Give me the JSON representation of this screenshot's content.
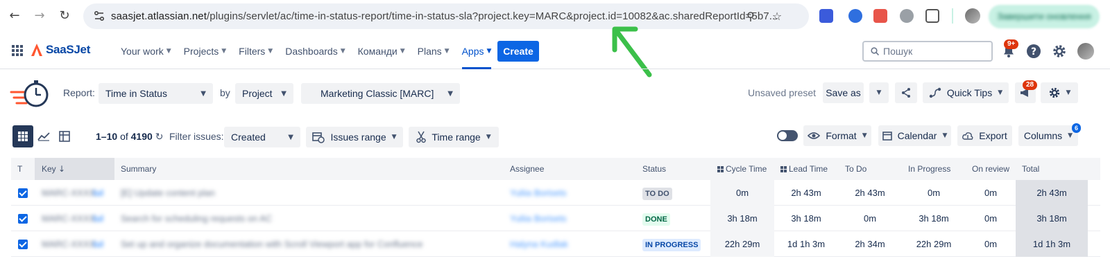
{
  "browser": {
    "url_host": "saasjet.atlassian.net",
    "url_path": "/plugins/servlet/ac/time-in-status-report/time-in-status-sla?project.key=MARC&project.id=10082&ac.sharedReportId=5b7...",
    "update_button_label": "Завершити оновлення"
  },
  "jira_nav": {
    "logo_text": "SaaSJet",
    "items": [
      {
        "label": "Your work"
      },
      {
        "label": "Projects"
      },
      {
        "label": "Filters"
      },
      {
        "label": "Dashboards"
      },
      {
        "label": "Команди"
      },
      {
        "label": "Plans"
      },
      {
        "label": "Apps"
      }
    ],
    "create_label": "Create",
    "search_placeholder": "Пошук",
    "notifications_badge": "9+"
  },
  "report_bar": {
    "report_label": "Report:",
    "report_value": "Time in Status",
    "by_label": "by",
    "by_value": "Project",
    "project_value": "Marketing Classic [MARC]",
    "preset_status": "Unsaved preset",
    "save_as_label": "Save as",
    "quick_tips_label": "Quick Tips",
    "alerts_badge": "28"
  },
  "filter_bar": {
    "range_start": "1",
    "range_end": "10",
    "of_label": "of",
    "total_count": "4190",
    "filter_label": "Filter issues:",
    "filter_value": "Created",
    "issues_range_label": "Issues range",
    "time_range_label": "Time range",
    "format_label": "Format",
    "calendar_label": "Calendar",
    "export_label": "Export",
    "columns_label": "Columns",
    "columns_badge": "6"
  },
  "table": {
    "headers": {
      "t": "T",
      "key": "Key",
      "summary": "Summary",
      "assignee": "Assignee",
      "status": "Status",
      "cycle_time": "Cycle Time",
      "lead_time": "Lead Time",
      "to_do": "To Do",
      "in_progress": "In Progress",
      "on_review": "On review",
      "total": "Total"
    },
    "rows": [
      {
        "key": "MARC-XXXX",
        "summary": "[E] Update content plan",
        "assignee": "Yuliia Borisets",
        "status": "TO DO",
        "cycle_time": "0m",
        "lead_time": "2h 43m",
        "to_do": "2h 43m",
        "in_progress": "0m",
        "on_review": "0m",
        "total": "2h 43m"
      },
      {
        "key": "MARC-XXXX",
        "summary": "Search for scheduling requests on AC",
        "assignee": "Yuliia Borisets",
        "status": "DONE",
        "cycle_time": "3h 18m",
        "lead_time": "3h 18m",
        "to_do": "0m",
        "in_progress": "3h 18m",
        "on_review": "0m",
        "total": "3h 18m"
      },
      {
        "key": "MARC-XXXX",
        "summary": "Set up and organize documentation with Scroll Viewport app for Confluence",
        "assignee": "Halyna Kudlak",
        "status": "IN PROGRESS",
        "cycle_time": "22h 29m",
        "lead_time": "1d 1h 3m",
        "to_do": "2h 34m",
        "in_progress": "22h 29m",
        "on_review": "0m",
        "total": "1d 1h 3m"
      }
    ]
  },
  "colors": {
    "jira_blue": "#0c66e4",
    "arrow_green": "#3cc04a",
    "badge_red": "#de350b"
  }
}
